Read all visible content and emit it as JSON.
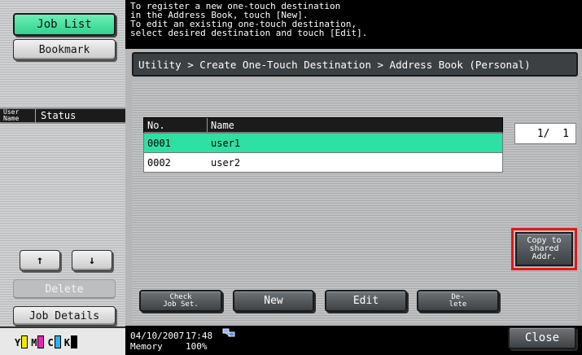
{
  "left_panel": {
    "job_list_label": "Job List",
    "bookmark_label": "Bookmark",
    "user_name_label_1": "User",
    "user_name_label_2": "Name",
    "status_label": "Status",
    "up_arrow": "↑",
    "down_arrow": "↓",
    "delete_label": "Delete",
    "job_details_label": "Job Details",
    "toner": [
      {
        "letter": "Y",
        "color": "#f5e600"
      },
      {
        "letter": "M",
        "color": "#e02bb0"
      },
      {
        "letter": "C",
        "color": "#22b6e8"
      },
      {
        "letter": "K",
        "color": "#000000"
      }
    ]
  },
  "message": {
    "line1": "To register a new one-touch destination",
    "line2": "in the Address Book, touch [New].",
    "line3": "To edit an existing one-touch destination,",
    "line4": "select desired destination and touch [Edit]."
  },
  "breadcrumb": "Utility > Create One-Touch Destination > Address Book (Personal)",
  "table": {
    "headers": {
      "no": "No.",
      "name": "Name"
    },
    "rows": [
      {
        "no": "0001",
        "name": "user1",
        "selected": true
      },
      {
        "no": "0002",
        "name": "user2",
        "selected": false
      }
    ]
  },
  "page_counter": "1/  1",
  "copy_button_label": "Copy to\nshared\nAddr.",
  "bottom_buttons": {
    "check_job_set_1": "Check",
    "check_job_set_2": "Job Set.",
    "new": "New",
    "edit": "Edit",
    "delete_1": "De-",
    "delete_2": "lete"
  },
  "status": {
    "date": "04/10/2007",
    "time": "17:48",
    "memory_label": "Memory",
    "memory_value": "100%",
    "close_label": "Close"
  }
}
